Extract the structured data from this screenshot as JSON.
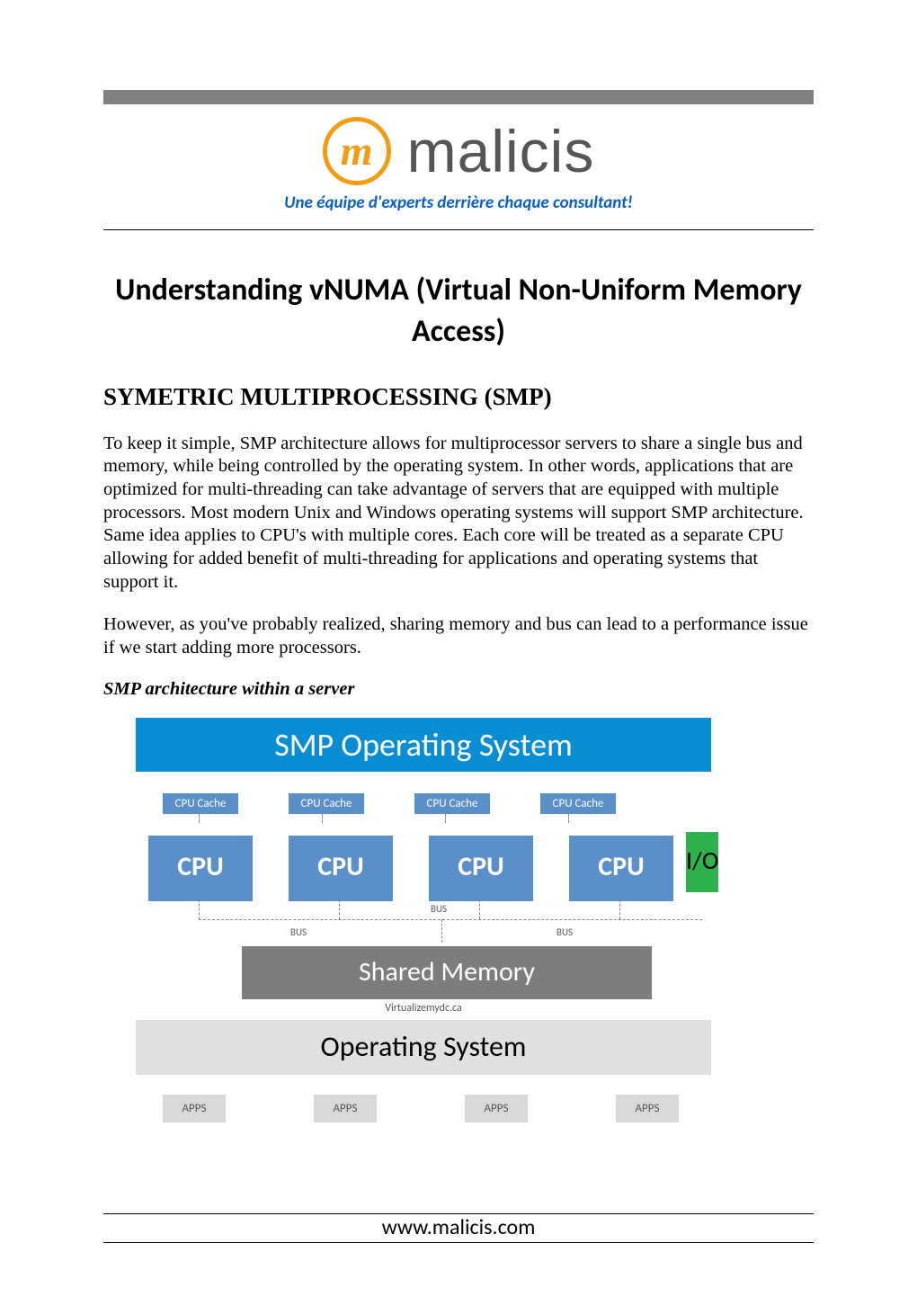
{
  "brand": {
    "logo_letter": "m",
    "logo_word": "malicis",
    "tagline": "Une équipe d'experts derrière chaque consultant!"
  },
  "document": {
    "title": "Understanding vNUMA (Virtual Non-Uniform Memory Access)",
    "section_heading": "SYMETRIC MULTIPROCESSING (SMP)",
    "para1": "To keep it simple, SMP architecture allows for multiprocessor servers to share a single bus and memory, while being controlled by the operating system. In other words, applications that are optimized for multi-threading can take advantage of servers that are equipped with multiple processors. Most modern Unix and Windows operating systems will support SMP architecture. Same idea applies to CPU's with multiple cores. Each core will be treated as a separate CPU allowing for added benefit of multi-threading for applications and operating systems that support it.",
    "para2": "However, as you've probably realized, sharing memory and bus can lead to a performance issue if we start adding more processors.",
    "figure_caption": "SMP architecture within a server"
  },
  "diagram": {
    "header": "SMP Operating System",
    "cache_label": "CPU Cache",
    "cpu_label": "CPU",
    "io_label": "I/O",
    "bus_label": "BUS",
    "shared_memory": "Shared Memory",
    "watermark": "Virtualizemydc.ca",
    "os_bar": "Operating System",
    "app_label": "APPS",
    "colors": {
      "header_bg": "#0a8ed3",
      "cpu_bg": "#5a8fc9",
      "io_bg": "#2fb14e",
      "shared_bg": "#7d7d7d",
      "os_bg": "#e0e0e0",
      "apps_bg": "#d9d9d9"
    },
    "counts": {
      "cpus": 4,
      "caches": 4,
      "apps": 4
    }
  },
  "footer": {
    "url": "www.malicis.com"
  }
}
